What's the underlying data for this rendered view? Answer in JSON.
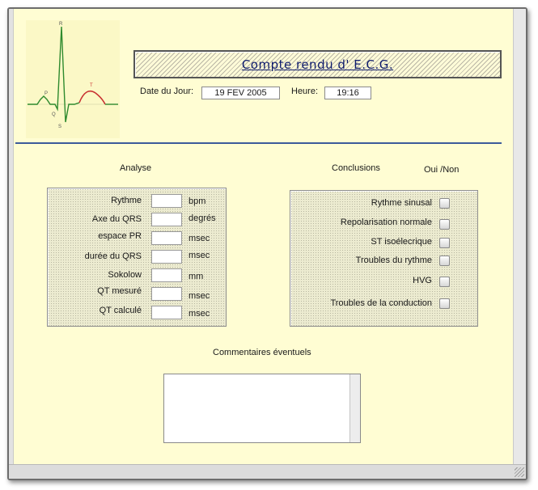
{
  "header": {
    "title": "Compte rendu d' E.C.G.",
    "date_label": "Date du Jour:",
    "date_value": "19 FEV 2005",
    "time_label": "Heure:",
    "time_value": "19:16"
  },
  "ecg_image": {
    "wave_labels": {
      "p": "P",
      "q": "Q",
      "r": "R",
      "s": "S",
      "t": "T"
    }
  },
  "analyse": {
    "title": "Analyse",
    "rows": [
      {
        "label": "Rythme",
        "value": "",
        "unit": "bpm"
      },
      {
        "label": "Axe du QRS",
        "value": "",
        "unit": "degrés"
      },
      {
        "label": "espace PR",
        "value": "",
        "unit": "msec"
      },
      {
        "label": "durée du QRS",
        "value": "",
        "unit": "msec"
      },
      {
        "label": "Sokolow",
        "value": "",
        "unit": "mm"
      },
      {
        "label": "QT mesuré",
        "value": "",
        "unit": "msec"
      },
      {
        "label": "QT calculé",
        "value": "",
        "unit": "msec"
      }
    ]
  },
  "conclusions": {
    "title": "Conclusions",
    "yes_no_label": "Oui /Non",
    "rows": [
      {
        "label": "Rythme sinusal",
        "checked": false
      },
      {
        "label": "Repolarisation normale",
        "checked": false
      },
      {
        "label": "ST isoélecrique",
        "checked": false
      },
      {
        "label": "Troubles du rythme",
        "checked": false
      },
      {
        "label": "HVG",
        "checked": false
      },
      {
        "label": "Troubles de la conduction",
        "checked": false
      }
    ]
  },
  "comments": {
    "label": "Commentaires éventuels",
    "value": ""
  },
  "colors": {
    "background": "#fffdd3",
    "title_text": "#0d1b6d",
    "divider": "#3c5a9a",
    "ecg_trace": "#2e8a2e",
    "ecg_t_wave": "#c83232"
  }
}
